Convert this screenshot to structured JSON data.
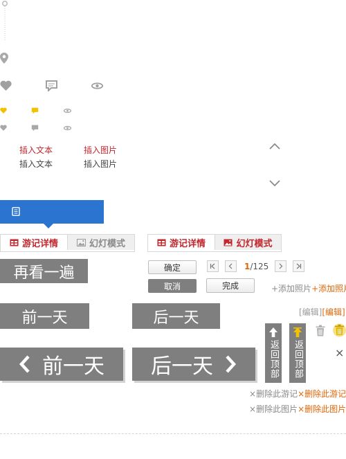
{
  "insert": {
    "text_active": "插入文本",
    "image_active": "插入图片",
    "text_normal": "插入文本",
    "image_normal": "插入图片"
  },
  "tabs_a": {
    "detail": "游记详情",
    "slideshow": "幻灯模式"
  },
  "tabs_b": {
    "detail": "游记详情",
    "slideshow": "幻灯模式"
  },
  "replay_label": "再看一遍",
  "confirm_label": "确定",
  "cancel_label": "取消",
  "done_label": "完成",
  "pager": {
    "current": "1",
    "total": "/125"
  },
  "add_photo": {
    "normal": "+添加照片",
    "hover": "+添加照片"
  },
  "edit": {
    "normal": "[编辑]",
    "hover": "[编辑]"
  },
  "prev_day": "前一天",
  "next_day": "后一天",
  "prev_day_large": "前一天",
  "next_day_large": "后一天",
  "back_top": {
    "normal": "返回顶部",
    "hover": "返回顶部"
  },
  "delete_note": {
    "normal": "删除此游记",
    "hover": "删除此游记"
  },
  "delete_image": {
    "normal": "删除此图片",
    "hover": "删除此图片"
  },
  "close_glyph": "×",
  "colors": {
    "accent_blue": "#2b74cf",
    "red": "#c1272d",
    "orange": "#e0670a",
    "gray_button": "#7f7f7f",
    "yellow": "#f2c200"
  },
  "icons": [
    "map-pin-icon",
    "heart-icon",
    "comment-icon",
    "eye-icon",
    "chevron-up-icon",
    "chevron-down-icon",
    "table-icon",
    "image-icon",
    "trash-icon",
    "arrow-up-icon"
  ]
}
